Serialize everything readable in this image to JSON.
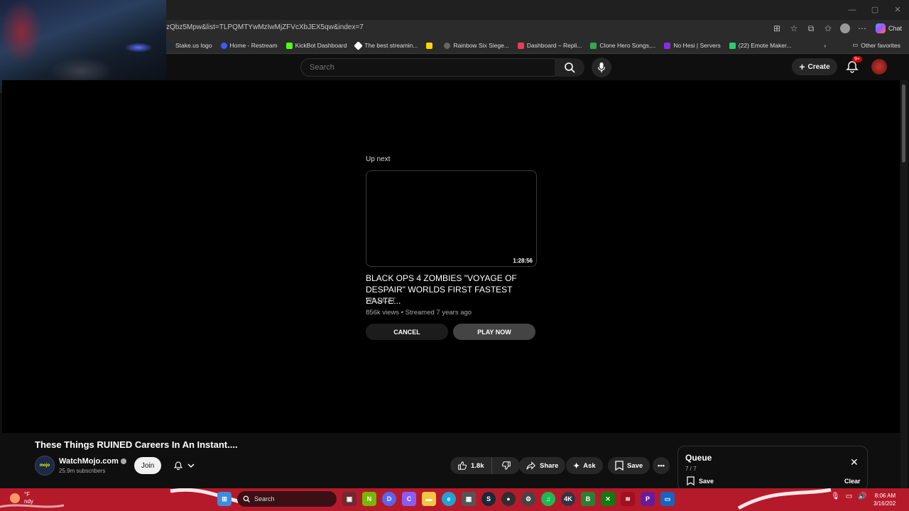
{
  "browser": {
    "url": "zQbz5Mpw&list=TLPQMTYwMzIwMjZFVcXbJEX5qw&index=7",
    "chat_label": "Chat",
    "window_controls": [
      "—",
      "▢",
      "✕"
    ],
    "bookmarks": [
      {
        "label": "Stake.us logo",
        "color": "#1a2c38"
      },
      {
        "label": "Home - Restream",
        "color": "#3b5bfd"
      },
      {
        "label": "KickBot Dashboard",
        "color": "#53fc18"
      },
      {
        "label": "The best streamin...",
        "color": "#ffffff"
      },
      {
        "label": "",
        "color": "#f5d60a"
      },
      {
        "label": "Rainbow Six Siege...",
        "color": "#666666"
      },
      {
        "label": "Dashboard – Repli...",
        "color": "#e83e5a"
      },
      {
        "label": "Clone Hero Songs,...",
        "color": "#34a853"
      },
      {
        "label": "No Hesi | Servers",
        "color": "#8a2be2"
      },
      {
        "label": "(22) Emote Maker...",
        "color": "#2ecc71"
      }
    ],
    "other_favorites": "Other favorites"
  },
  "youtube_header": {
    "search_placeholder": "Search",
    "create_label": "Create",
    "notification_badge": "9+"
  },
  "up_next": {
    "label": "Up next",
    "duration": "1:28:56",
    "title": "BLACK OPS 4 ZOMBIES \"VOYAGE OF DESPAIR\" WORLDS FIRST FASTEST EASTE...",
    "channel": "WILDCAT",
    "meta": "856k views • Streamed 7 years ago",
    "cancel_label": "CANCEL",
    "play_label": "PLAY NOW"
  },
  "video": {
    "title": "These Things RUINED Careers In An Instant....",
    "channel_name": "WatchMojo.com",
    "subscribers": "25.9m subscribers",
    "join_label": "Join",
    "likes": "1.8k",
    "share_label": "Share",
    "ask_label": "Ask",
    "save_label": "Save"
  },
  "queue": {
    "title": "Queue",
    "count": "7 / 7",
    "save_label": "Save",
    "clear_label": "Clear"
  },
  "taskbar": {
    "weather_temp": "°F",
    "weather_desc": "ndy",
    "search_label": "Search",
    "time": "8:06 AM",
    "date": "3/16/202"
  },
  "colors": {
    "accent_red": "#cc0000",
    "taskbar_bg": "#b51a2a",
    "page_bg": "#0f0f0f"
  }
}
